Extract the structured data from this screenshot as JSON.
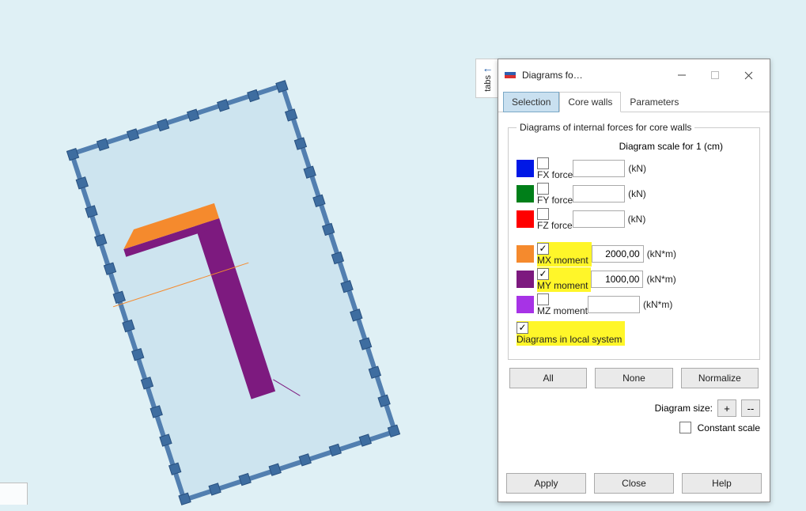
{
  "tabs_handle": {
    "label": "tabs"
  },
  "dialog": {
    "title": "Diagrams fo…",
    "tabs": {
      "selection": "Selection",
      "core_walls": "Core walls",
      "parameters": "Parameters"
    },
    "group_title": "Diagrams of internal forces for core walls",
    "scale_header": "Diagram scale for 1 (cm)",
    "forces": [
      {
        "key": "fx",
        "color": "#0018e6",
        "label": "FX force",
        "checked": false,
        "value": "",
        "unit": "(kN)",
        "highlighted": false
      },
      {
        "key": "fy",
        "color": "#007f19",
        "label": "FY force",
        "checked": false,
        "value": "",
        "unit": "(kN)",
        "highlighted": false
      },
      {
        "key": "fz",
        "color": "#ff0000",
        "label": "FZ force",
        "checked": false,
        "value": "",
        "unit": "(kN)",
        "highlighted": false
      }
    ],
    "moments": [
      {
        "key": "mx",
        "color": "#f58a2d",
        "label": "MX moment",
        "checked": true,
        "value": "2000,00",
        "unit": "(kN*m)",
        "highlighted": true
      },
      {
        "key": "my",
        "color": "#7d1a7f",
        "label": "MY moment",
        "checked": true,
        "value": "1000,00",
        "unit": "(kN*m)",
        "highlighted": true
      },
      {
        "key": "mz",
        "color": "#a733e6",
        "label": "MZ moment",
        "checked": false,
        "value": "",
        "unit": "(kN*m)",
        "highlighted": false
      }
    ],
    "local_system": {
      "checked": true,
      "label": "Diagrams in local system",
      "highlighted": true
    },
    "buttons": {
      "all": "All",
      "none": "None",
      "normalize": "Normalize",
      "apply": "Apply",
      "close": "Close",
      "help": "Help"
    },
    "diagram_size": {
      "label": "Diagram size:",
      "plus": "+",
      "minus": "--"
    },
    "constant_scale": {
      "checked": false,
      "label": "Constant scale"
    }
  }
}
